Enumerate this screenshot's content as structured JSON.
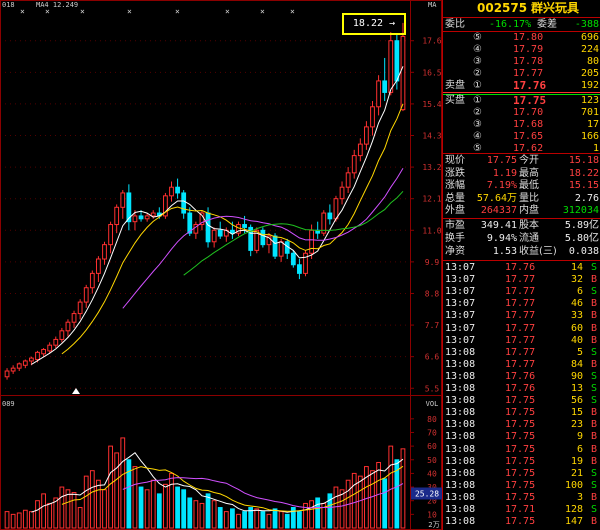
{
  "stock": {
    "code": "002575",
    "name": "群兴玩具"
  },
  "chart_top_left": {
    "id": "018",
    "ma4": "MA4 12.249"
  },
  "chart_top_right": "MA",
  "max_callout": {
    "text": "18.22",
    "arrow": "→"
  },
  "price_axis": [
    "17.6",
    "16.5",
    "15.4",
    "14.3",
    "13.2",
    "12.1",
    "11.0",
    "9.9",
    "8.8",
    "7.7",
    "6.6",
    "5.5"
  ],
  "volume_axis_label": "VOL",
  "volume_axis": [
    "80",
    "70",
    "60",
    "50",
    "40",
    "30",
    "20",
    "10"
  ],
  "volume_current": "25.28",
  "volume_unit": "2万",
  "volume_topleft": "089",
  "weibi": {
    "label": "委比",
    "value": "-16.17%",
    "label2": "委差",
    "value2": "-388"
  },
  "asks": [
    {
      "label": "⑤",
      "price": "17.80",
      "vol": "696"
    },
    {
      "label": "④",
      "price": "17.79",
      "vol": "224"
    },
    {
      "label": "③",
      "price": "17.78",
      "vol": "80"
    },
    {
      "label": "②",
      "price": "17.77",
      "vol": "205"
    },
    {
      "label": "①",
      "price": "17.76",
      "vol": "192"
    }
  ],
  "bids": [
    {
      "label": "①",
      "price": "17.75",
      "vol": "123"
    },
    {
      "label": "②",
      "price": "17.70",
      "vol": "701"
    },
    {
      "label": "③",
      "price": "17.68",
      "vol": "17"
    },
    {
      "label": "④",
      "price": "17.65",
      "vol": "166"
    },
    {
      "label": "⑤",
      "price": "17.62",
      "vol": "1"
    }
  ],
  "sell_label": "卖盘",
  "buy_label": "买盘",
  "stats": [
    {
      "l1": "现价",
      "v1": "17.75",
      "l2": "今开",
      "v2": "15.18",
      "c1": "red",
      "c2": "red"
    },
    {
      "l1": "涨跌",
      "v1": "1.19",
      "l2": "最高",
      "v2": "18.22",
      "c1": "red",
      "c2": "red"
    },
    {
      "l1": "涨幅",
      "v1": "7.19%",
      "l2": "最低",
      "v2": "15.15",
      "c1": "red",
      "c2": "red"
    },
    {
      "l1": "总量",
      "v1": "57.64万",
      "l2": "量比",
      "v2": "2.76",
      "c1": "yellow",
      "c2": "white"
    },
    {
      "l1": "外盘",
      "v1": "264337",
      "l2": "内盘",
      "v2": "312034",
      "c1": "red",
      "c2": "green"
    }
  ],
  "fundamentals": [
    {
      "l1": "市盈",
      "v1": "349.41",
      "l2": "股本",
      "v2": "5.89亿"
    },
    {
      "l1": "换手",
      "v1": "9.94%",
      "l2": "流通",
      "v2": "5.80亿"
    },
    {
      "l1": "净资",
      "v1": "1.53",
      "l2": "收益(三)",
      "v2": "0.038"
    }
  ],
  "ticks": [
    {
      "time": "13:07",
      "price": "17.76",
      "vol": "14",
      "side": "S"
    },
    {
      "time": "13:07",
      "price": "17.77",
      "vol": "32",
      "side": "B"
    },
    {
      "time": "13:07",
      "price": "17.77",
      "vol": "6",
      "side": "S"
    },
    {
      "time": "13:07",
      "price": "17.77",
      "vol": "46",
      "side": "B"
    },
    {
      "time": "13:07",
      "price": "17.77",
      "vol": "33",
      "side": "B"
    },
    {
      "time": "13:07",
      "price": "17.77",
      "vol": "60",
      "side": "B"
    },
    {
      "time": "13:07",
      "price": "17.77",
      "vol": "40",
      "side": "B"
    },
    {
      "time": "13:08",
      "price": "17.77",
      "vol": "5",
      "side": "S"
    },
    {
      "time": "13:08",
      "price": "17.77",
      "vol": "84",
      "side": "B"
    },
    {
      "time": "13:08",
      "price": "17.76",
      "vol": "90",
      "side": "S"
    },
    {
      "time": "13:08",
      "price": "17.76",
      "vol": "13",
      "side": "S"
    },
    {
      "time": "13:08",
      "price": "17.75",
      "vol": "56",
      "side": "S"
    },
    {
      "time": "13:08",
      "price": "17.75",
      "vol": "15",
      "side": "B"
    },
    {
      "time": "13:08",
      "price": "17.75",
      "vol": "23",
      "side": "B"
    },
    {
      "time": "13:08",
      "price": "17.75",
      "vol": "9",
      "side": "B"
    },
    {
      "time": "13:08",
      "price": "17.75",
      "vol": "6",
      "side": "B"
    },
    {
      "time": "13:08",
      "price": "17.75",
      "vol": "19",
      "side": "B"
    },
    {
      "time": "13:08",
      "price": "17.75",
      "vol": "21",
      "side": "S"
    },
    {
      "time": "13:08",
      "price": "17.75",
      "vol": "100",
      "side": "S"
    },
    {
      "time": "13:08",
      "price": "17.75",
      "vol": "3",
      "side": "B"
    },
    {
      "time": "13:08",
      "price": "17.71",
      "vol": "128",
      "side": "S"
    },
    {
      "time": "13:08",
      "price": "17.75",
      "vol": "147",
      "side": "B"
    }
  ],
  "colors": {
    "up": "#ff3030",
    "down": "#00e5ff",
    "ma1": "#ffffff",
    "ma2": "#ffd700",
    "ma3": "#d050ff",
    "ma4": "#20c020",
    "grid": "#8b0000"
  },
  "chart_data": {
    "type": "candlestick",
    "ohlc": [
      [
        5.9,
        6.2,
        5.8,
        6.1
      ],
      [
        6.1,
        6.3,
        6.0,
        6.2
      ],
      [
        6.2,
        6.4,
        6.1,
        6.35
      ],
      [
        6.3,
        6.5,
        6.2,
        6.45
      ],
      [
        6.45,
        6.6,
        6.3,
        6.55
      ],
      [
        6.5,
        6.8,
        6.4,
        6.75
      ],
      [
        6.7,
        6.9,
        6.6,
        6.85
      ],
      [
        6.8,
        7.1,
        6.7,
        7.0
      ],
      [
        7.0,
        7.3,
        6.9,
        7.2
      ],
      [
        7.2,
        7.6,
        7.1,
        7.5
      ],
      [
        7.5,
        7.9,
        7.3,
        7.8
      ],
      [
        7.8,
        8.2,
        7.6,
        8.1
      ],
      [
        8.1,
        8.6,
        7.9,
        8.5
      ],
      [
        8.5,
        9.1,
        8.3,
        9.0
      ],
      [
        9.0,
        9.6,
        8.8,
        9.5
      ],
      [
        9.5,
        10.1,
        9.2,
        10.0
      ],
      [
        10.0,
        10.6,
        9.8,
        10.5
      ],
      [
        10.5,
        11.3,
        10.2,
        11.2
      ],
      [
        11.2,
        11.9,
        10.9,
        11.8
      ],
      [
        11.8,
        12.4,
        11.4,
        12.3
      ],
      [
        12.3,
        12.6,
        11.0,
        11.3
      ],
      [
        11.3,
        11.7,
        11.0,
        11.5
      ],
      [
        11.5,
        11.7,
        11.3,
        11.4
      ],
      [
        11.4,
        11.6,
        11.3,
        11.5
      ],
      [
        11.5,
        11.7,
        11.4,
        11.6
      ],
      [
        11.6,
        11.8,
        11.4,
        11.5
      ],
      [
        11.5,
        12.3,
        11.4,
        12.2
      ],
      [
        12.2,
        12.7,
        12.0,
        12.5
      ],
      [
        12.5,
        12.8,
        12.1,
        12.3
      ],
      [
        12.3,
        12.4,
        11.4,
        11.6
      ],
      [
        11.6,
        11.8,
        10.8,
        10.9
      ],
      [
        10.9,
        11.3,
        10.7,
        11.2
      ],
      [
        11.2,
        11.7,
        11.0,
        11.6
      ],
      [
        11.6,
        11.8,
        10.4,
        10.6
      ],
      [
        10.6,
        11.1,
        10.4,
        11.0
      ],
      [
        11.0,
        11.3,
        10.7,
        10.8
      ],
      [
        10.8,
        11.1,
        10.6,
        11.0
      ],
      [
        11.0,
        11.3,
        10.7,
        10.9
      ],
      [
        10.9,
        11.3,
        10.8,
        11.2
      ],
      [
        11.2,
        11.5,
        10.9,
        11.1
      ],
      [
        11.1,
        11.2,
        10.1,
        10.3
      ],
      [
        10.3,
        11.1,
        10.2,
        11.0
      ],
      [
        11.0,
        11.1,
        10.4,
        10.5
      ],
      [
        10.5,
        10.9,
        10.2,
        10.8
      ],
      [
        10.8,
        10.9,
        10.0,
        10.1
      ],
      [
        10.1,
        10.7,
        9.9,
        10.6
      ],
      [
        10.6,
        10.7,
        10.0,
        10.2
      ],
      [
        10.2,
        10.3,
        9.7,
        9.8
      ],
      [
        9.8,
        10.0,
        9.3,
        9.5
      ],
      [
        9.5,
        10.3,
        9.4,
        10.2
      ],
      [
        10.2,
        11.2,
        10.0,
        11.0
      ],
      [
        11.0,
        11.3,
        10.7,
        10.9
      ],
      [
        10.9,
        11.7,
        10.8,
        11.6
      ],
      [
        11.6,
        11.9,
        11.2,
        11.4
      ],
      [
        11.4,
        12.2,
        11.3,
        12.1
      ],
      [
        12.1,
        12.7,
        11.9,
        12.5
      ],
      [
        12.5,
        13.2,
        12.3,
        13.0
      ],
      [
        13.0,
        13.8,
        12.8,
        13.6
      ],
      [
        13.6,
        14.2,
        13.4,
        14.0
      ],
      [
        14.0,
        14.8,
        13.8,
        14.6
      ],
      [
        14.6,
        15.5,
        14.3,
        15.3
      ],
      [
        15.3,
        16.4,
        15.0,
        16.2
      ],
      [
        16.2,
        17.0,
        15.5,
        15.8
      ],
      [
        15.8,
        17.9,
        15.7,
        17.6
      ],
      [
        17.6,
        17.8,
        15.9,
        16.2
      ],
      [
        15.2,
        18.22,
        15.15,
        17.75
      ]
    ],
    "volume": [
      12,
      10,
      11,
      13,
      12,
      20,
      25,
      18,
      22,
      30,
      28,
      26,
      15,
      38,
      42,
      35,
      28,
      60,
      55,
      66,
      50,
      45,
      30,
      28,
      35,
      25,
      32,
      40,
      30,
      28,
      22,
      20,
      18,
      25,
      20,
      15,
      12,
      14,
      10,
      12,
      15,
      14,
      12,
      10,
      14,
      12,
      10,
      15,
      12,
      18,
      20,
      22,
      18,
      25,
      30,
      28,
      35,
      40,
      38,
      45,
      42,
      48,
      36,
      60,
      50,
      58
    ],
    "volume_color": [
      "up",
      "up",
      "up",
      "up",
      "up",
      "up",
      "up",
      "up",
      "up",
      "up",
      "up",
      "up",
      "up",
      "up",
      "up",
      "up",
      "up",
      "up",
      "up",
      "up",
      "down",
      "up",
      "down",
      "up",
      "up",
      "down",
      "up",
      "up",
      "down",
      "down",
      "down",
      "up",
      "up",
      "down",
      "up",
      "down",
      "up",
      "down",
      "up",
      "down",
      "down",
      "up",
      "down",
      "up",
      "down",
      "up",
      "down",
      "down",
      "down",
      "up",
      "up",
      "down",
      "up",
      "down",
      "up",
      "up",
      "up",
      "up",
      "up",
      "up",
      "up",
      "up",
      "down",
      "up",
      "down",
      "up"
    ],
    "ylim": [
      5.3,
      18.6
    ],
    "vol_ylim": [
      0,
      85
    ]
  }
}
